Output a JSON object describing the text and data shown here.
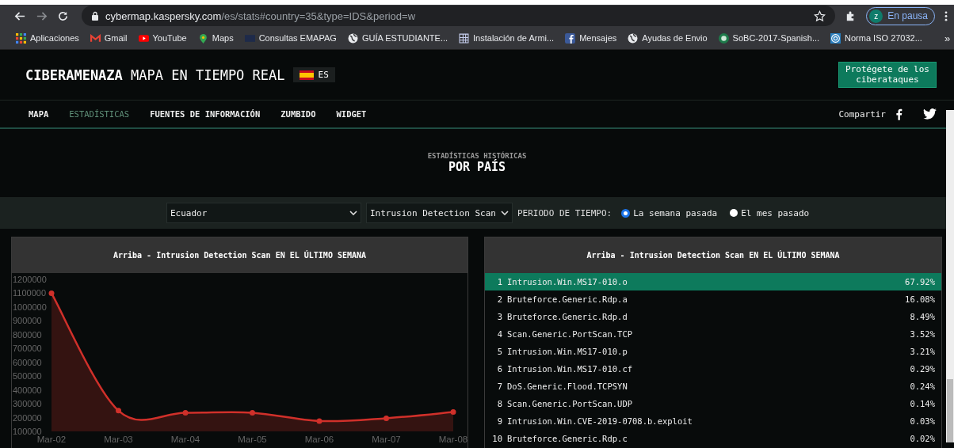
{
  "browser": {
    "url_host": "cybermap.kaspersky.com",
    "url_path": "/es/stats#country=35&type=IDS&period=w",
    "profile_initial": "z",
    "profile_status": "En pausa",
    "bookmarks": [
      {
        "kind": "apps",
        "label": "Aplicaciones"
      },
      {
        "kind": "mail",
        "label": "Gmail"
      },
      {
        "kind": "video",
        "label": "YouTube"
      },
      {
        "kind": "pin",
        "label": "Maps"
      },
      {
        "kind": "page",
        "label": "Consultas EMAPAG"
      },
      {
        "kind": "globe",
        "label": "GUÍA ESTUDIANTE..."
      },
      {
        "kind": "grid",
        "label": "Instalación de Armi..."
      },
      {
        "kind": "social",
        "label": "Mensajes"
      },
      {
        "kind": "globe",
        "label": "Ayudas de Envio"
      },
      {
        "kind": "emblem",
        "label": "SoBC-2017-Spanish..."
      },
      {
        "kind": "target",
        "label": "Norma ISO 27032..."
      }
    ],
    "overflow": "»"
  },
  "header": {
    "title": "**CIBERAMENAZA** MAPA EN TIEMPO REAL",
    "language": "ES",
    "cta": "Protégete de los ciberataques"
  },
  "nav": {
    "items": [
      {
        "label": "MAPA",
        "selected": false
      },
      {
        "label": "ESTADÍSTICAS",
        "selected": true
      },
      {
        "label": "FUENTES DE INFORMACIÓN",
        "selected": false
      },
      {
        "label": "ZUMBIDO",
        "selected": false
      },
      {
        "label": "WIDGET",
        "selected": false
      }
    ],
    "share": "Compartir"
  },
  "hero": {
    "subtitle": "ESTADÍSTICAS HISTÓRICAS",
    "title": "POR PAÍS"
  },
  "filters": {
    "country": "Ecuador",
    "type": "Intrusion Detection Scan",
    "period_label": "PERIODO DE TIEMPO:",
    "periods": [
      {
        "label": "La semana pasada",
        "selected": true
      },
      {
        "label": "El mes pasado",
        "selected": false
      }
    ]
  },
  "chart_panel": {
    "title": "Arriba - Intrusion Detection Scan EN EL ÚLTIMO SEMANA",
    "chart_data": {
      "type": "area",
      "categories": [
        "Mar-02",
        "Mar-03",
        "Mar-04",
        "Mar-05",
        "Mar-06",
        "Mar-07",
        "Mar-08"
      ],
      "series": [
        {
          "color": "#d0302a",
          "values": [
            1100000,
            250000,
            235000,
            235000,
            175000,
            195000,
            240000
          ]
        }
      ],
      "ylim": [
        100000,
        1200000
      ],
      "yticks": [
        100000,
        200000,
        300000,
        400000,
        500000,
        600000,
        700000,
        800000,
        900000,
        1000000,
        1100000,
        1200000
      ]
    }
  },
  "top_panel": {
    "title": "Arriba - Intrusion Detection Scan EN EL ÚLTIMO SEMANA",
    "rows": [
      {
        "rank": "1",
        "name": "Intrusion.Win.MS17-010.o",
        "share": "67.92%",
        "selected": true
      },
      {
        "rank": "2",
        "name": "Bruteforce.Generic.Rdp.a",
        "share": "16.08%",
        "selected": false
      },
      {
        "rank": "3",
        "name": "Bruteforce.Generic.Rdp.d",
        "share": "8.49%",
        "selected": false
      },
      {
        "rank": "4",
        "name": "Scan.Generic.PortScan.TCP",
        "share": "3.52%",
        "selected": false
      },
      {
        "rank": "5",
        "name": "Intrusion.Win.MS17-010.p",
        "share": "3.21%",
        "selected": false
      },
      {
        "rank": "6",
        "name": "Intrusion.Win.MS17-010.cf",
        "share": "0.29%",
        "selected": false
      },
      {
        "rank": "7",
        "name": "DoS.Generic.Flood.TCPSYN",
        "share": "0.24%",
        "selected": false
      },
      {
        "rank": "8",
        "name": "Scan.Generic.PortScan.UDP",
        "share": "0.14%",
        "selected": false
      },
      {
        "rank": "9",
        "name": "Intrusion.Win.CVE-2019-0708.b.exploit",
        "share": "0.03%",
        "selected": false
      },
      {
        "rank": "10",
        "name": "Bruteforce.Generic.Rdp.c",
        "share": "0.02%",
        "selected": false
      }
    ]
  }
}
